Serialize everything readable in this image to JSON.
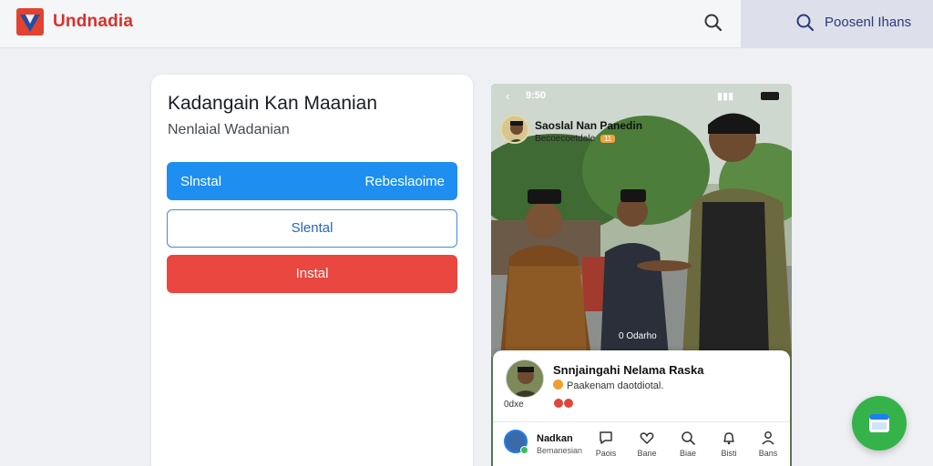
{
  "app": {
    "brand": "Undnadia",
    "colors": {
      "brand_red": "#d8312a",
      "brand_blue": "#1e4fa8",
      "accent_green": "#35b34a"
    }
  },
  "header": {
    "search_icon": "search-icon",
    "right_panel_label": "Poosenl Ihans"
  },
  "card": {
    "title": "Kadangain Kan Maanian",
    "subtitle": "Nenlaial Wadanian",
    "primary_button": {
      "left_label": "Slnstal",
      "right_label": "Rebeslaoime",
      "color": "#1e8ff0"
    },
    "outline_button_label": "Slental",
    "danger_button_label": "Instal"
  },
  "phone": {
    "status_time": "9:50",
    "post": {
      "author": "Saoslal Nan Panedin",
      "meta": "Becoecoetdale",
      "meta_tag": "11",
      "photo_caption": "0 Odarho"
    },
    "info_card": {
      "name": "Snnjaingahi Nelama Raska",
      "description": "Paakenam daotdiotal.",
      "sub_label": "0dxe"
    },
    "nav": {
      "user_name": "Nadkan",
      "user_sub": "Bemanesian",
      "items": [
        {
          "label": "Paois",
          "icon": "chat-icon"
        },
        {
          "label": "Bane",
          "icon": "heart-icon"
        },
        {
          "label": "Biae",
          "icon": "search-icon"
        },
        {
          "label": "Bisti",
          "icon": "bell-icon"
        },
        {
          "label": "Bans",
          "icon": "user-icon"
        }
      ]
    }
  },
  "fab": {
    "icon": "window-icon"
  }
}
